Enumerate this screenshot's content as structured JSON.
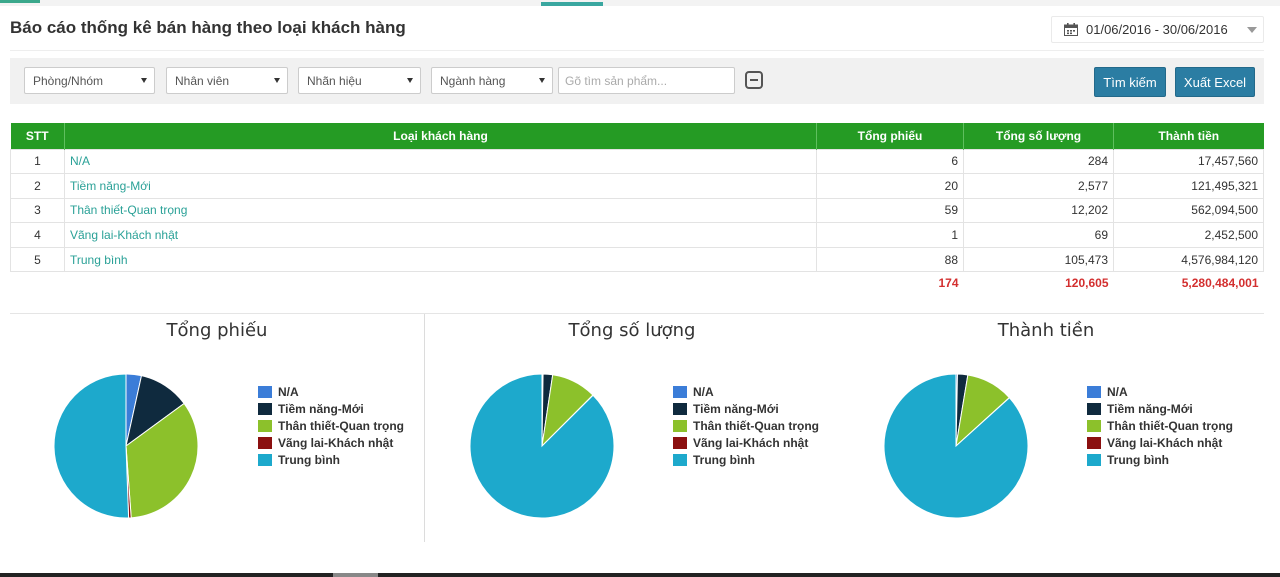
{
  "page": {
    "title": "Báo cáo thống kê bán hàng theo loại khách hàng",
    "date_range": "01/06/2016 - 30/06/2016"
  },
  "filters": {
    "group": "Phòng/Nhóm",
    "staff": "Nhân viên",
    "brand": "Nhãn hiệu",
    "category": "Ngành hàng",
    "search_placeholder": "Gõ tìm sản phẩm...",
    "search_button": "Tìm kiếm",
    "export_button": "Xuất Excel"
  },
  "table": {
    "headers": [
      "STT",
      "Loại khách hàng",
      "Tổng phiếu",
      "Tổng số lượng",
      "Thành tiền"
    ],
    "rows": [
      {
        "stt": "1",
        "name": "N/A",
        "orders": "6",
        "qty": "284",
        "amount": "17,457,560"
      },
      {
        "stt": "2",
        "name": "Tiềm năng-Mới",
        "orders": "20",
        "qty": "2,577",
        "amount": "121,495,321"
      },
      {
        "stt": "3",
        "name": "Thân thiết-Quan trọng",
        "orders": "59",
        "qty": "12,202",
        "amount": "562,094,500"
      },
      {
        "stt": "4",
        "name": "Vãng lai-Khách nhật",
        "orders": "1",
        "qty": "69",
        "amount": "2,452,500"
      },
      {
        "stt": "5",
        "name": "Trung bình",
        "orders": "88",
        "qty": "105,473",
        "amount": "4,576,984,120"
      }
    ],
    "totals": {
      "orders": "174",
      "qty": "120,605",
      "amount": "5,280,484,001"
    }
  },
  "colors": {
    "header_bg": "#259b24",
    "link": "#2aa197",
    "total": "#d32f2f",
    "button": "#2b7da3",
    "series": [
      "#3b7dd8",
      "#0f2a3e",
      "#8cc12b",
      "#8b1010",
      "#1da9cc"
    ]
  },
  "icons": {
    "date": "calendar-icon",
    "clear": "minus-square-icon"
  },
  "chart_data": [
    {
      "type": "pie",
      "title": "Tổng phiếu",
      "categories": [
        "N/A",
        "Tiềm năng-Mới",
        "Thân thiết-Quan trọng",
        "Vãng lai-Khách nhật",
        "Trung bình"
      ],
      "values": [
        6,
        20,
        59,
        1,
        88
      ],
      "legend": "right"
    },
    {
      "type": "pie",
      "title": "Tổng số lượng",
      "categories": [
        "N/A",
        "Tiềm năng-Mới",
        "Thân thiết-Quan trọng",
        "Vãng lai-Khách nhật",
        "Trung bình"
      ],
      "values": [
        284,
        2577,
        12202,
        69,
        105473
      ],
      "legend": "right"
    },
    {
      "type": "pie",
      "title": "Thành tiền",
      "categories": [
        "N/A",
        "Tiềm năng-Mới",
        "Thân thiết-Quan trọng",
        "Vãng lai-Khách nhật",
        "Trung bình"
      ],
      "values": [
        17457560,
        121495321,
        562094500,
        2452500,
        4576984120
      ],
      "legend": "right"
    }
  ]
}
